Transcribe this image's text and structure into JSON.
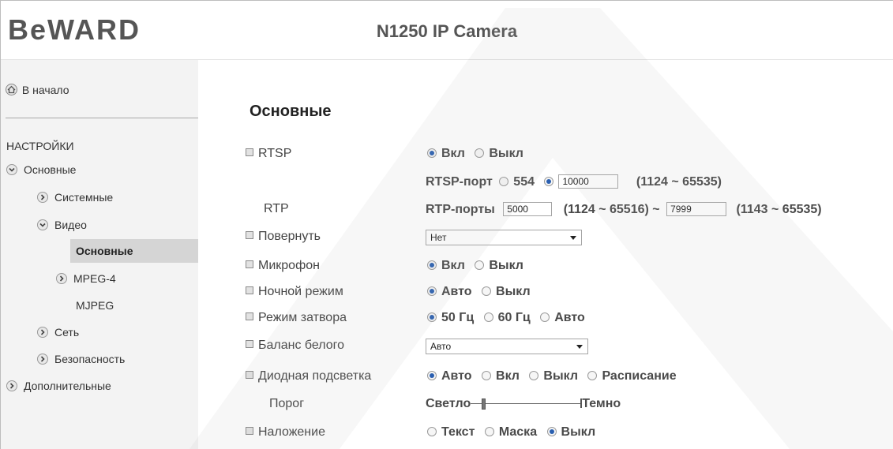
{
  "header": {
    "logo": "BeWARD",
    "title": "N1250 IP Camera"
  },
  "sidebar": {
    "home": "В начало",
    "settings_head": "НАСТРОЙКИ",
    "items": [
      {
        "label": "Основные"
      },
      {
        "label": "Системные"
      },
      {
        "label": "Видео"
      },
      {
        "label": "Основные"
      },
      {
        "label": "MPEG-4"
      },
      {
        "label": "MJPEG"
      },
      {
        "label": "Сеть"
      },
      {
        "label": "Безопасность"
      },
      {
        "label": "Дополнительные"
      }
    ]
  },
  "main": {
    "section_title": "Основные",
    "rtsp": {
      "label": "RTSP",
      "on": "Вкл",
      "off": "Выкл",
      "selected": "Вкл",
      "port_label": "RTSP-порт",
      "port_default": "554",
      "port_value": "10000",
      "port_range": "(1124 ~ 65535)"
    },
    "rtp": {
      "label": "RTP",
      "ports_label": "RTP-порты",
      "port_from": "5000",
      "range_from": "(1124 ~ 65516) ~",
      "port_to": "7999",
      "range_to": "(1143 ~ 65535)"
    },
    "rotate": {
      "label": "Повернуть",
      "value": "Нет"
    },
    "mic": {
      "label": "Микрофон",
      "on": "Вкл",
      "off": "Выкл",
      "selected": "Вкл"
    },
    "night": {
      "label": "Ночной режим",
      "auto": "Авто",
      "off": "Выкл",
      "selected": "Авто"
    },
    "shutter": {
      "label": "Режим затвора",
      "opt1": "50 Гц",
      "opt2": "60 Гц",
      "opt3": "Авто",
      "selected": "50 Гц"
    },
    "wb": {
      "label": "Баланс белого",
      "value": "Авто"
    },
    "led": {
      "label": "Диодная подсветка",
      "auto": "Авто",
      "on": "Вкл",
      "off": "Выкл",
      "schedule": "Расписание",
      "selected": "Авто"
    },
    "threshold": {
      "label": "Порог",
      "left": "Светло",
      "right": "Темно",
      "level": 0.1
    },
    "overlay": {
      "label": "Наложение",
      "text": "Текст",
      "mask": "Маска",
      "off": "Выкл",
      "selected": "Выкл"
    }
  }
}
